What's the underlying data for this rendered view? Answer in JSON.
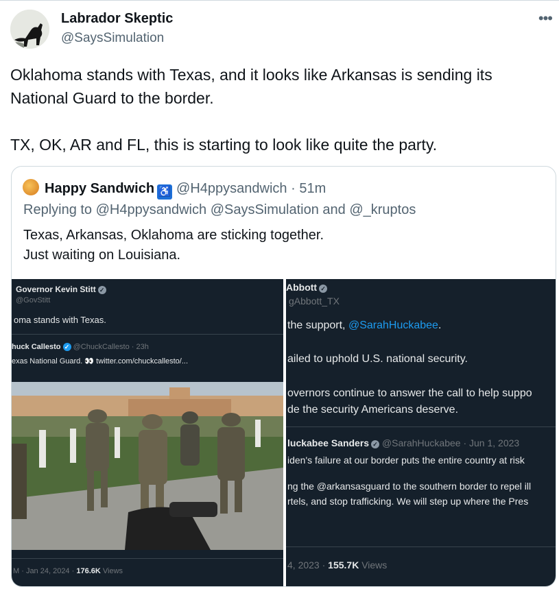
{
  "tweet": {
    "display_name": "Labrador Skeptic",
    "handle": "@SaysSimulation",
    "more_label": "•••",
    "text_lines": [
      "Oklahoma stands with Texas, and it looks like Arkansas is sending its National Guard to the border.",
      "TX, OK, AR and FL, this is starting to look like quite the party."
    ]
  },
  "quote": {
    "display_name": "Happy Sandwich",
    "badge_icon": "wheelchair-icon",
    "handle": "@H4ppysandwich",
    "separator": "·",
    "time": "51m",
    "reply_prefix": "Replying to",
    "reply_mention1": "@H4ppysandwich",
    "reply_mention2": "@SaysSimulation",
    "reply_and": "and",
    "reply_mention3": "@_kruptos",
    "text_line1": "Texas, Arkansas, Oklahoma are sticking together.",
    "text_line2": "Just waiting on Louisiana."
  },
  "left_screenshot": {
    "author_name": "Governor Kevin Stitt",
    "author_handle": "@GovStitt",
    "text": "oma stands with Texas.",
    "quoted_name": "huck Callesto",
    "quoted_meta": "@ChuckCallesto · 23h",
    "quoted_text": "exas National Guard. 👀 twitter.com/chuckcallesto/...",
    "footer_date": "M · Jan 24, 2024 ·",
    "footer_views_count": "176.6K",
    "footer_views_label": "Views"
  },
  "right_screenshot": {
    "author_name": "Abbott",
    "author_handle": "gAbbott_TX",
    "line1_text": "the support,",
    "line1_mention": "@SarahHuckabee",
    "line1_end": ".",
    "line2": "ailed to uphold U.S. national security.",
    "line3": "overnors continue to answer the call to help suppo",
    "line4": "de the security Americans deserve.",
    "quoted_name": "luckabee Sanders",
    "quoted_meta": "@SarahHuckabee · Jun 1, 2023",
    "quoted_line1": "iden's failure at our border puts the entire country at risk",
    "quoted_line2": "ng the @arkansasguard to the southern border to repel ill",
    "quoted_line3": "rtels, and stop trafficking. We will step up where the Pres",
    "footer_date": "4, 2023 ·",
    "footer_views_count": "155.7K",
    "footer_views_label": "Views"
  }
}
